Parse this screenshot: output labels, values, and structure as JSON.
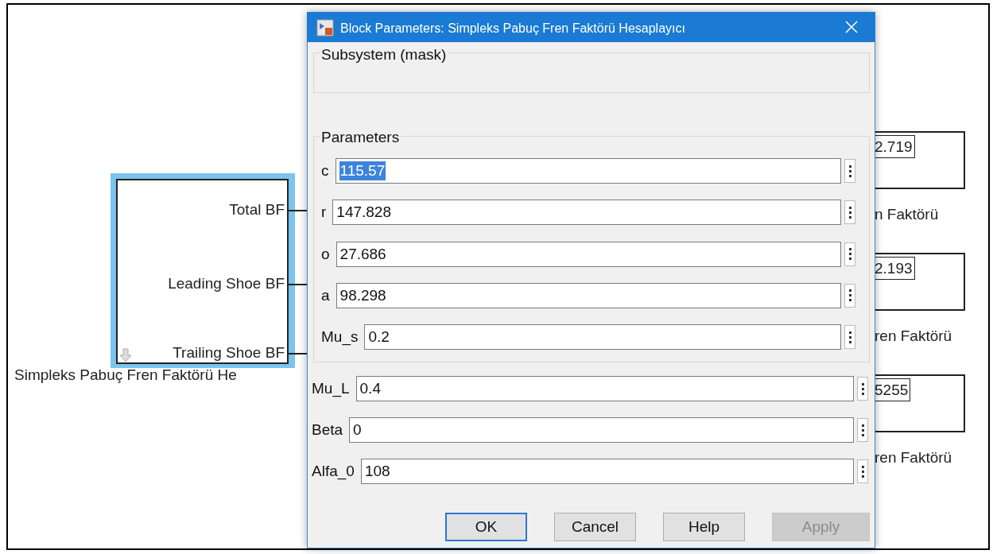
{
  "block": {
    "ports": [
      "Total BF",
      "Leading Shoe BF",
      "Trailing Shoe BF"
    ],
    "caption": "Simpleks Pabuç Fren Faktörü He",
    "selected": true
  },
  "display_values": [
    "2.719",
    "2.193",
    "5255"
  ],
  "block_captions": [
    "n Faktörü",
    "ren Faktörü",
    "ren Faktörü"
  ],
  "dialog": {
    "title": "Block Parameters: Simpleks Pabuç Fren Faktörü Hesaplayıcı",
    "description_group": "Subsystem (mask)",
    "parameters_group": "Parameters",
    "group_fields": [
      {
        "label": "c",
        "value": "115.57",
        "text_selected": true
      },
      {
        "label": "r",
        "value": "147.828",
        "text_selected": false
      },
      {
        "label": "o",
        "value": "27.686",
        "text_selected": false
      },
      {
        "label": "a",
        "value": "98.298",
        "text_selected": false
      },
      {
        "label": "Mu_s",
        "value": "0.2",
        "text_selected": false
      }
    ],
    "extra_fields": [
      {
        "label": "Mu_L",
        "value": "0.4",
        "text_selected": false
      },
      {
        "label": "Beta",
        "value": "0",
        "text_selected": false
      },
      {
        "label": "Alfa_0",
        "value": "108",
        "text_selected": false
      }
    ],
    "buttons": [
      {
        "label": "OK",
        "default": true,
        "disabled": false
      },
      {
        "label": "Cancel",
        "default": false,
        "disabled": false
      },
      {
        "label": "Help",
        "default": false,
        "disabled": false
      },
      {
        "label": "Apply",
        "default": false,
        "disabled": true
      }
    ]
  }
}
